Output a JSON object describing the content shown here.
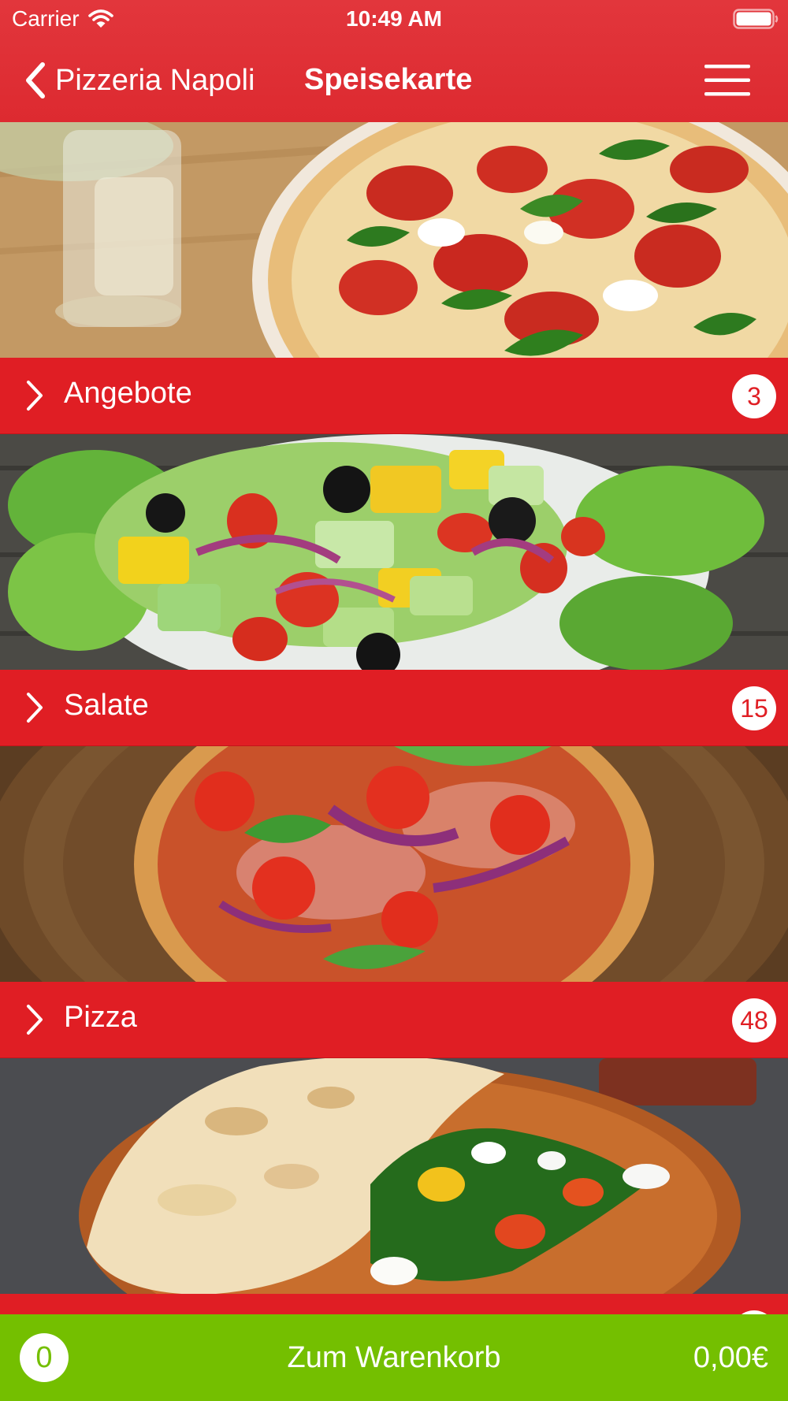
{
  "status_bar": {
    "carrier": "Carrier",
    "time": "10:49 AM"
  },
  "nav": {
    "back_label": "Pizzeria Napoli",
    "title": "Speisekarte"
  },
  "categories": [
    {
      "label": "Angebote",
      "count": "3"
    },
    {
      "label": "Salate",
      "count": "15"
    },
    {
      "label": "Pizza",
      "count": "48"
    },
    {
      "label": "",
      "count": ""
    }
  ],
  "cart": {
    "count": "0",
    "label": "Zum Warenkorb",
    "total": "0,00€"
  },
  "colors": {
    "header_red": "#dd2a30",
    "category_red": "#e01e24",
    "cart_green": "#74bf00"
  }
}
